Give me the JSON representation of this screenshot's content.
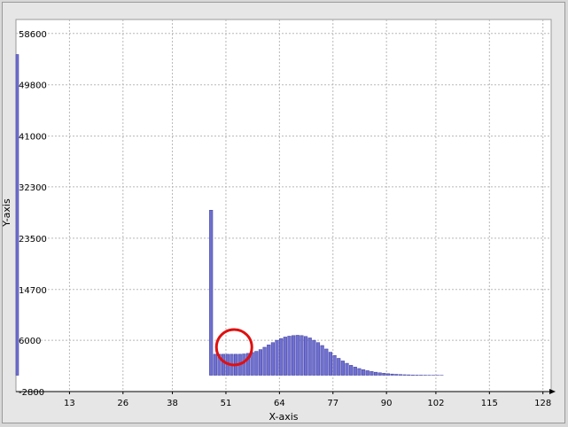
{
  "chart_data": {
    "type": "bar",
    "title": "",
    "xlabel": "X-axis",
    "ylabel": "Y-axis",
    "xlim": [
      0,
      130
    ],
    "ylim": [
      -2800,
      61000
    ],
    "xticks": [
      13,
      26,
      38,
      51,
      64,
      77,
      90,
      102,
      115,
      128
    ],
    "yticks": [
      -2800,
      6000,
      14700,
      23500,
      32300,
      41000,
      49800,
      58600
    ],
    "grid": true,
    "legend": "none",
    "bar_color": "#7070d0",
    "bar_edge": "#3a3aa0",
    "highlight_circle": {
      "x": 53,
      "y": 4800,
      "color": "#e01010"
    },
    "x": [
      0,
      47,
      48,
      49,
      50,
      51,
      52,
      53,
      54,
      55,
      56,
      57,
      58,
      59,
      60,
      61,
      62,
      63,
      64,
      65,
      66,
      67,
      68,
      69,
      70,
      71,
      72,
      73,
      74,
      75,
      76,
      77,
      78,
      79,
      80,
      81,
      82,
      83,
      84,
      85,
      86,
      87,
      88,
      89,
      90,
      91,
      92,
      93,
      94,
      95,
      96,
      97,
      98,
      99,
      100,
      101,
      102,
      103
    ],
    "values": [
      55000,
      28300,
      3600,
      3600,
      3600,
      3600,
      3600,
      3600,
      3600,
      3650,
      3750,
      3900,
      4100,
      4400,
      4800,
      5200,
      5600,
      6000,
      6300,
      6550,
      6700,
      6800,
      6850,
      6800,
      6650,
      6400,
      6000,
      5600,
      5100,
      4500,
      3950,
      3400,
      2900,
      2450,
      2050,
      1700,
      1400,
      1150,
      950,
      780,
      640,
      520,
      420,
      340,
      270,
      210,
      160,
      120,
      90,
      70,
      50,
      40,
      30,
      20,
      15,
      10,
      8,
      5
    ]
  }
}
